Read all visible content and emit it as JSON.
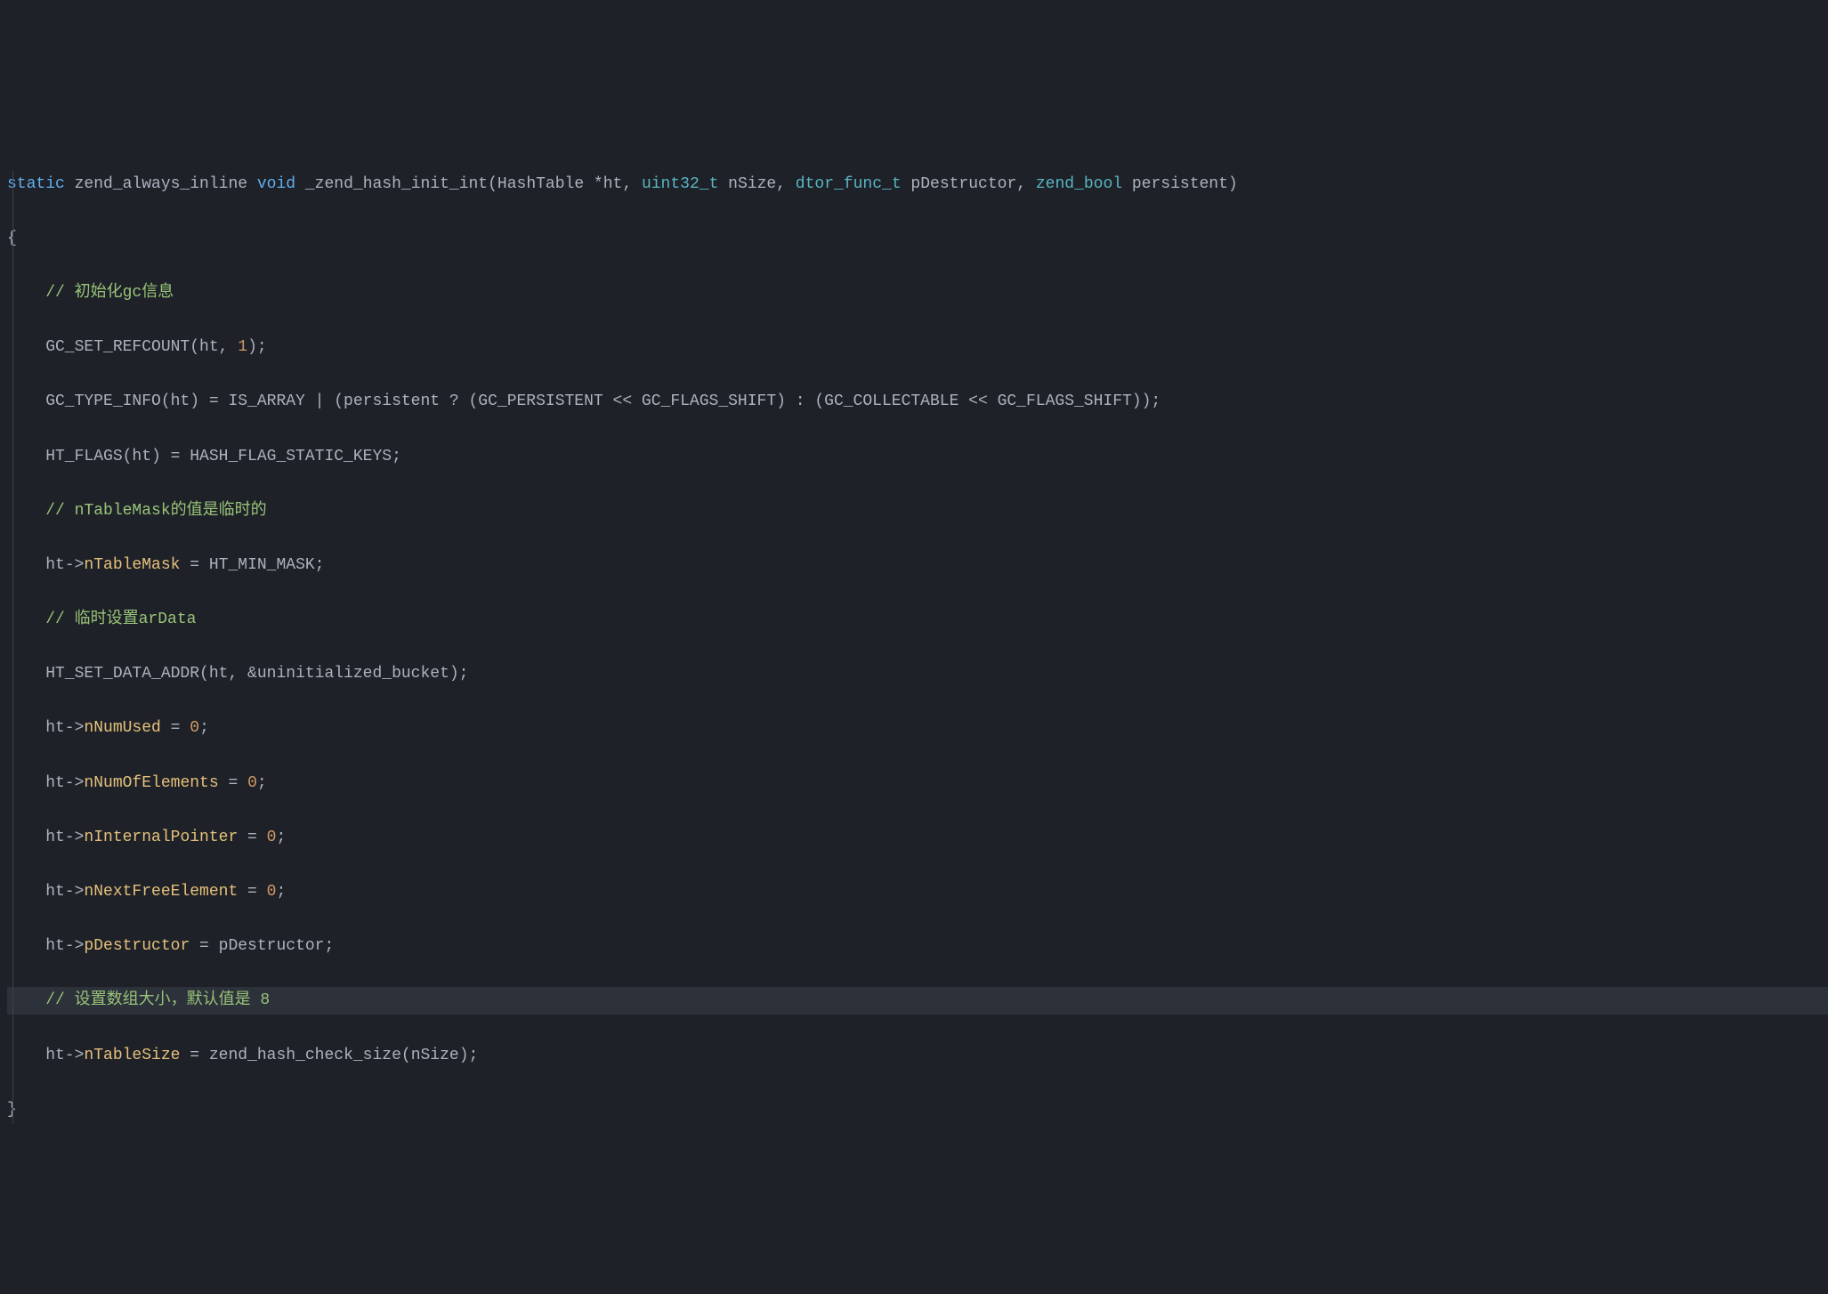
{
  "code": {
    "l1_static": "static",
    "l1_inline": " zend_always_inline ",
    "l1_void": "void",
    "l1_fn": " _zend_hash_init_int(HashTable *ht, ",
    "l1_u32": "uint32_t",
    "l1_nsize": " nSize, ",
    "l1_dtor": "dtor_func_t",
    "l1_pd": " pDestructor, ",
    "l1_bool": "zend_bool",
    "l1_pers": " persistent)",
    "l2": "{",
    "l3_comment": "    // 初始化gc信息",
    "l4": "    GC_SET_REFCOUNT(ht, ",
    "l4_num": "1",
    "l4_end": ");",
    "l5": "    GC_TYPE_INFO(ht) = IS_ARRAY | (persistent ? (GC_PERSISTENT << GC_FLAGS_SHIFT) : (GC_COLLECTABLE << GC_FLAGS_SHIFT));",
    "l6": "    HT_FLAGS(ht) = HASH_FLAG_STATIC_KEYS;",
    "l7_comment": "    // nTableMask的值是临时的",
    "l8_a": "    ht->",
    "l8_m": "nTableMask",
    "l8_b": " = HT_MIN_MASK;",
    "l9_comment": "    // 临时设置arData",
    "l10": "    HT_SET_DATA_ADDR(ht, &uninitialized_bucket);",
    "l11_a": "    ht->",
    "l11_m": "nNumUsed",
    "l11_b": " = ",
    "l11_n": "0",
    "l11_c": ";",
    "l12_a": "    ht->",
    "l12_m": "nNumOfElements",
    "l12_b": " = ",
    "l12_n": "0",
    "l12_c": ";",
    "l13_a": "    ht->",
    "l13_m": "nInternalPointer",
    "l13_b": " = ",
    "l13_n": "0",
    "l13_c": ";",
    "l14_a": "    ht->",
    "l14_m": "nNextFreeElement",
    "l14_b": " = ",
    "l14_n": "0",
    "l14_c": ";",
    "l15_a": "    ht->",
    "l15_m": "pDestructor",
    "l15_b": " = pDestructor;",
    "l16_comment": "    // 设置数组大小，默认值是 8",
    "l17_a": "    ht->",
    "l17_m": "nTableSize",
    "l17_b": " = zend_hash_check_size(nSize);",
    "l18": "}"
  }
}
